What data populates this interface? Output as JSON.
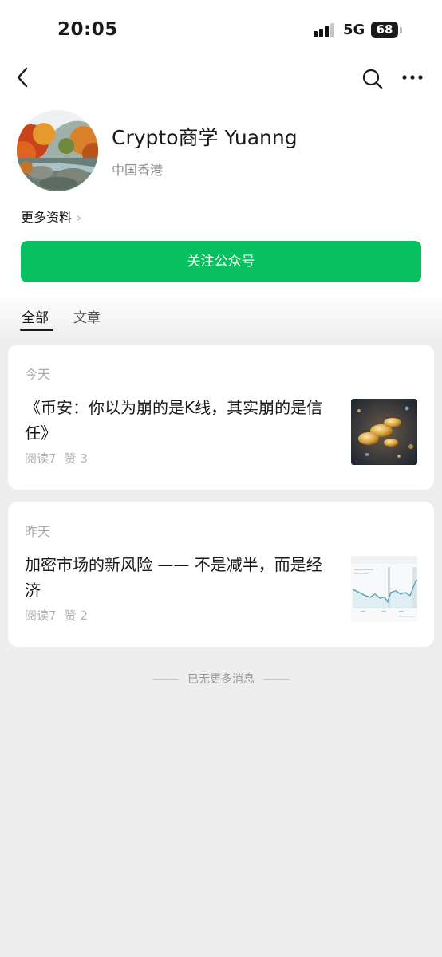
{
  "status": {
    "time": "20:05",
    "network": "5G",
    "battery": "68"
  },
  "nav": {
    "back_icon": "back-chevron-icon",
    "search_icon": "search-icon",
    "more_icon": "more-dots-icon"
  },
  "profile": {
    "name": "Crypto商学 Yuanng",
    "location": "中国香港",
    "more_info": "更多资料",
    "follow_label": "关注公众号"
  },
  "tabs": [
    {
      "label": "全部",
      "active": true
    },
    {
      "label": "文章",
      "active": false
    }
  ],
  "feed": [
    {
      "day": "今天",
      "title": "《币安：你以为崩的是K线，其实崩的是信任》",
      "reads": "阅读7",
      "likes": "赞 3"
    },
    {
      "day": "昨天",
      "title": "加密市场的新风险 —— 不是减半，而是经济",
      "reads": "阅读7",
      "likes": "赞 2"
    }
  ],
  "footer": {
    "no_more": "已无更多消息"
  },
  "colors": {
    "accent": "#07c160",
    "background": "#ededed"
  }
}
